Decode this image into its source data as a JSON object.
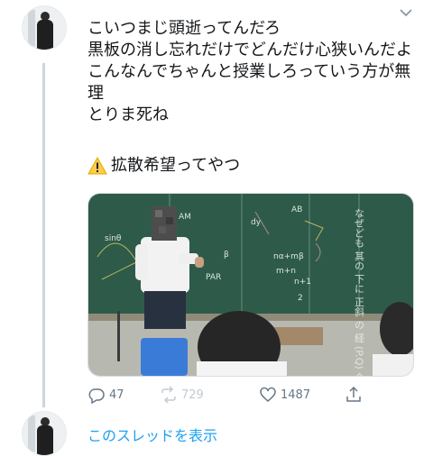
{
  "tweet": {
    "text": "こいつまじ頭逝ってんだろ\n黒板の消し忘れだけでどんだけ心狭いんだよこんなんでちゃんと授業しろっていう方が無理\nとりま死ね",
    "spread_text": "拡散希望ってやつ",
    "warning_icon": "warning-icon"
  },
  "chalkboard": {
    "cells": [
      "AB",
      "AM",
      "dy",
      "nα+mβ",
      "m+n",
      "n+1",
      "2",
      "sinθ",
      "PAR",
      "β"
    ],
    "right_text": "なぜども 其の 下に 正斜 の 経 (P.Q) 今 R"
  },
  "actions": {
    "reply_count": "47",
    "retweet_count": "729",
    "like_count": "1487"
  },
  "thread": {
    "show_label": "このスレッドを表示"
  }
}
